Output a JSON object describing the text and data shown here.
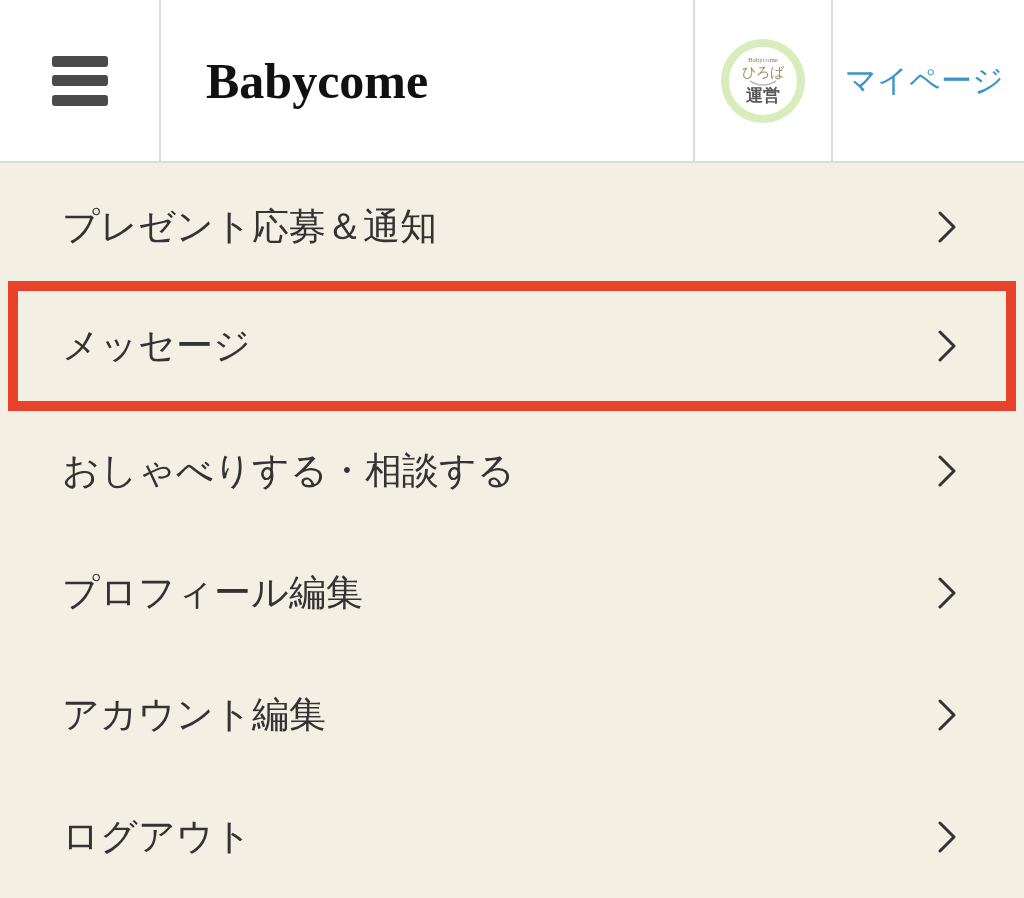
{
  "header": {
    "logo": "Babycome",
    "avatar": {
      "brand": "Babycome",
      "name": "ひろば",
      "role": "運営"
    },
    "mypage_link": "マイページ"
  },
  "menu": {
    "items": [
      {
        "label": "プレゼント応募＆通知",
        "highlighted": false
      },
      {
        "label": "メッセージ",
        "highlighted": true
      },
      {
        "label": "おしゃべりする・相談する",
        "highlighted": false
      },
      {
        "label": "プロフィール編集",
        "highlighted": false
      },
      {
        "label": "アカウント編集",
        "highlighted": false
      },
      {
        "label": "ログアウト",
        "highlighted": false
      }
    ]
  }
}
